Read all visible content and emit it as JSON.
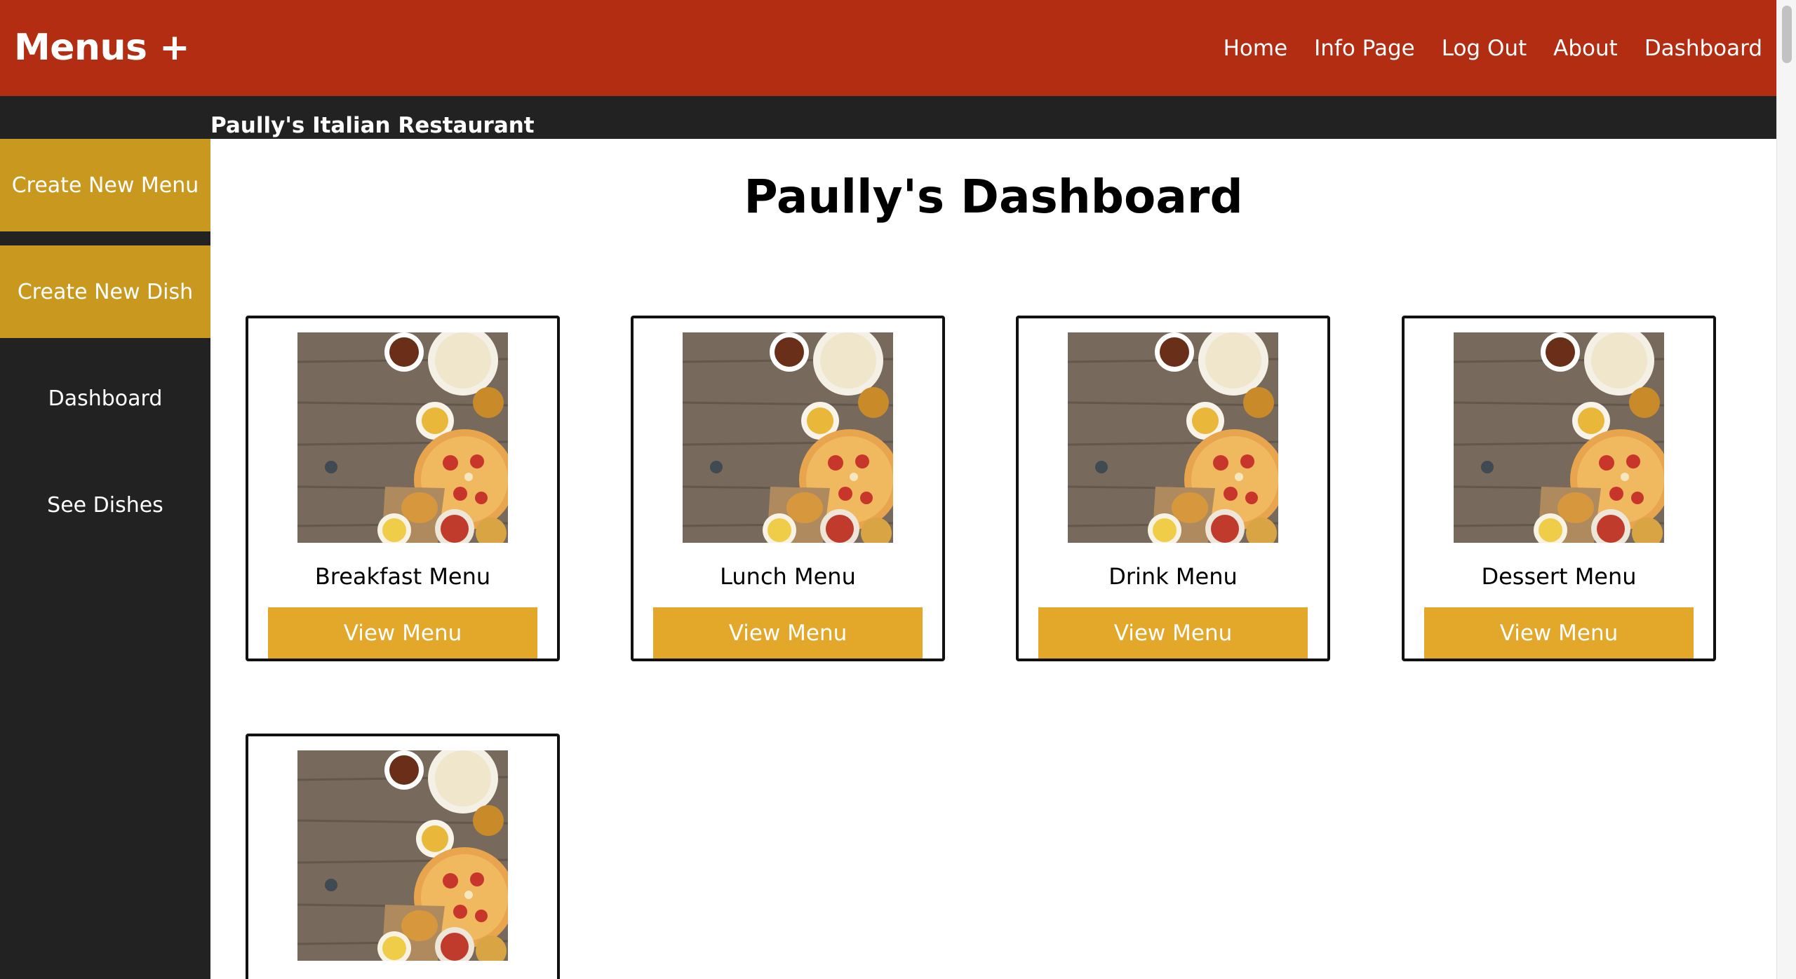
{
  "header": {
    "brand": "Menus +",
    "nav": [
      "Home",
      "Info Page",
      "Log Out",
      "About",
      "Dashboard"
    ]
  },
  "subheader": {
    "restaurant": "Paully's Italian Restaurant"
  },
  "sidebar": {
    "items": [
      {
        "label": "Create New Menu"
      },
      {
        "label": "Create New Dish"
      },
      {
        "label": "Dashboard"
      },
      {
        "label": "See Dishes"
      }
    ]
  },
  "main": {
    "title": "Paully's Dashboard",
    "cards": [
      {
        "name": "Breakfast Menu",
        "button": "View Menu"
      },
      {
        "name": "Lunch Menu",
        "button": "View Menu"
      },
      {
        "name": "Drink Menu",
        "button": "View Menu"
      },
      {
        "name": "Dessert Menu",
        "button": "View Menu"
      }
    ]
  },
  "colors": {
    "header": "#b22d12",
    "dark": "#222222",
    "sidebar_gold": "#c9991f",
    "button_gold": "#e3a829"
  }
}
